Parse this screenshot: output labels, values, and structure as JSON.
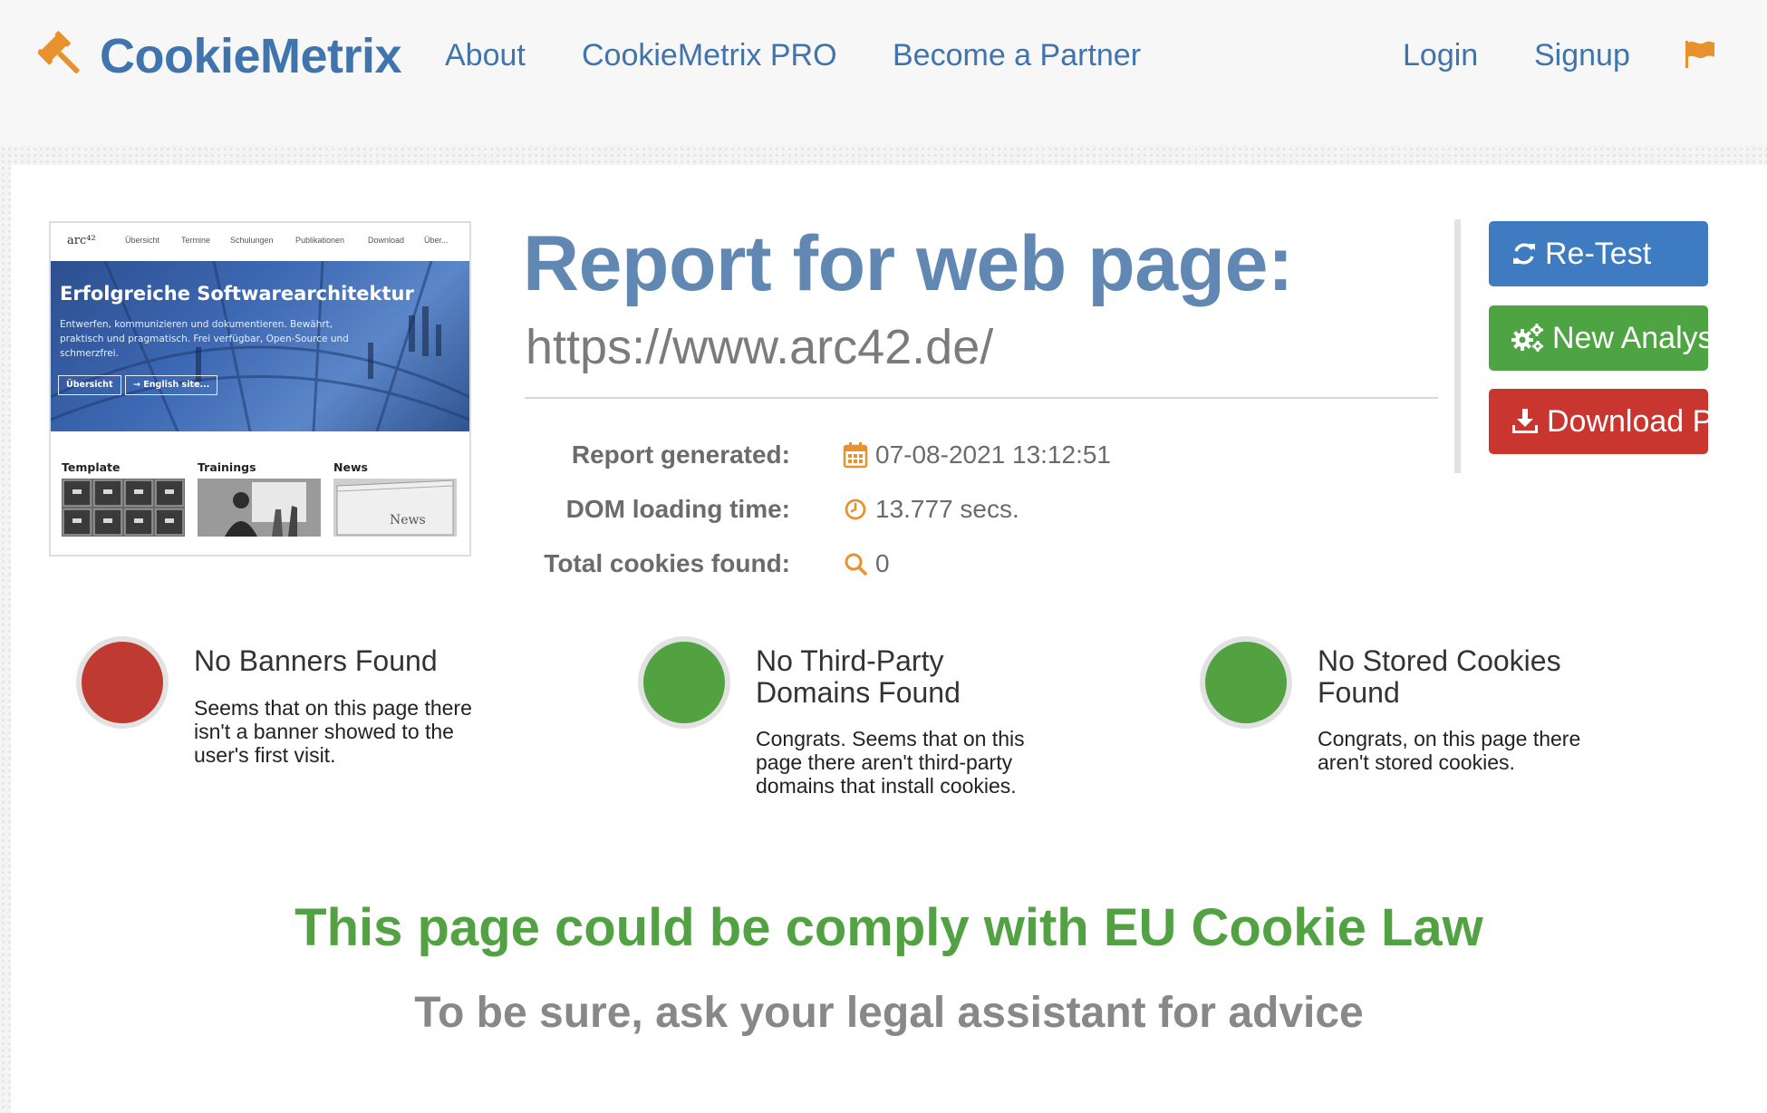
{
  "brand": {
    "name_part1": "Cookie",
    "name_part2": "Metrix",
    "accent": "#e8912f",
    "blue": "#3f74ac"
  },
  "nav": {
    "about": "About",
    "pro": "CookieMetrix PRO",
    "partner": "Become a Partner",
    "login": "Login",
    "signup": "Signup",
    "flag_icon": "flag-icon"
  },
  "thumbnail": {
    "logo": "arc⁴²",
    "menu": [
      "Übersicht",
      "Termine",
      "Schulungen",
      "Publikationen",
      "Download",
      "Über..."
    ],
    "hero_title": "Erfolgreiche Softwarearchitektur",
    "hero_text": "Entwerfen, kommunizieren und dokumentieren. Bewährt, praktisch und pragmatisch. Frei verfügbar, Open-Source und schmerzfrei.",
    "buttons": [
      "Übersicht",
      "→ English site..."
    ],
    "columns": [
      "Template",
      "Trainings",
      "News"
    ],
    "news_image_text": "News"
  },
  "report": {
    "title": "Report for web page:",
    "url": "https://www.arc42.de/",
    "generated_label": "Report generated:",
    "generated_value": "07-08-2021 13:12:51",
    "dom_label": "DOM loading time:",
    "dom_value": "13.777 secs.",
    "cookies_label": "Total cookies found:",
    "cookies_value": "0"
  },
  "actions": {
    "retest": "Re-Test",
    "new_analysis": "New Analysis",
    "download": "Download PDF"
  },
  "statuses": [
    {
      "title": "No Banners Found",
      "description": "Seems that on this page there isn't a banner showed to the user's first visit.",
      "color": "#bf3a30"
    },
    {
      "title": "No Third-Party Domains Found",
      "description": "Congrats. Seems that on this page there aren't third-party domains that install cookies.",
      "color": "#52a242"
    },
    {
      "title": "No Stored Cookies Found",
      "description": "Congrats, on this page there aren't stored cookies.",
      "color": "#52a242"
    }
  ],
  "verdict": {
    "main": "This page could be comply with EU Cookie Law",
    "sub": "To be sure, ask your legal assistant for advice",
    "color": "#52a243"
  }
}
